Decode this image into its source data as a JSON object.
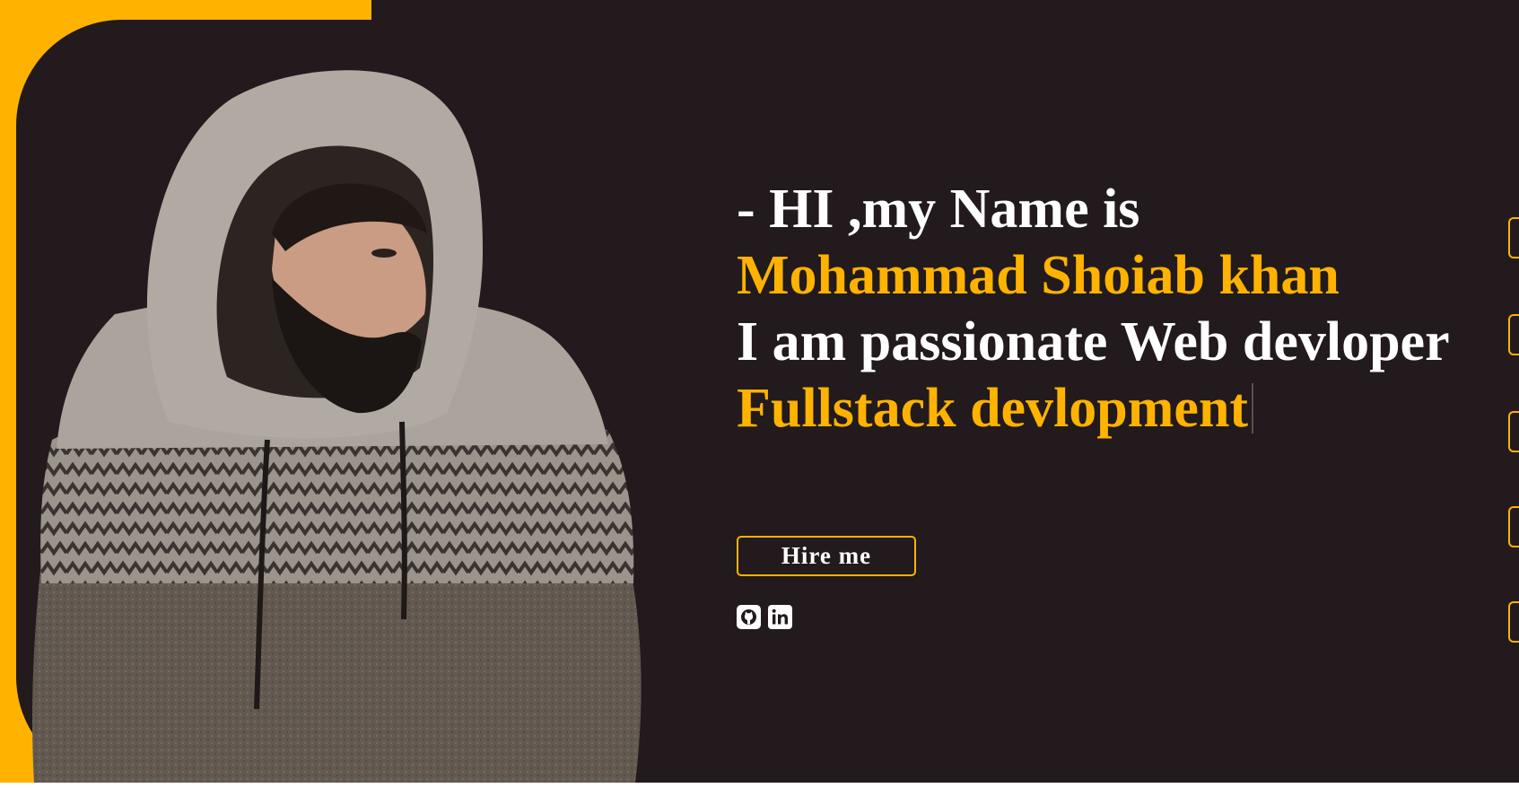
{
  "hero": {
    "greeting": "- HI ,my Name is",
    "name": "Mohammad Shoiab khan",
    "tagline": "I am passionate Web devloper",
    "typed_text": "Fullstack devlopment",
    "hire_button_label": "Hire me"
  },
  "social": [
    {
      "icon": "github-icon",
      "label": "GitHub"
    },
    {
      "icon": "linkedin-icon",
      "label": "LinkedIn"
    }
  ],
  "side_nav": {
    "tab_count": 5
  },
  "colors": {
    "accent": "#ffb300",
    "background": "#221a1c",
    "text": "#ffffff"
  }
}
